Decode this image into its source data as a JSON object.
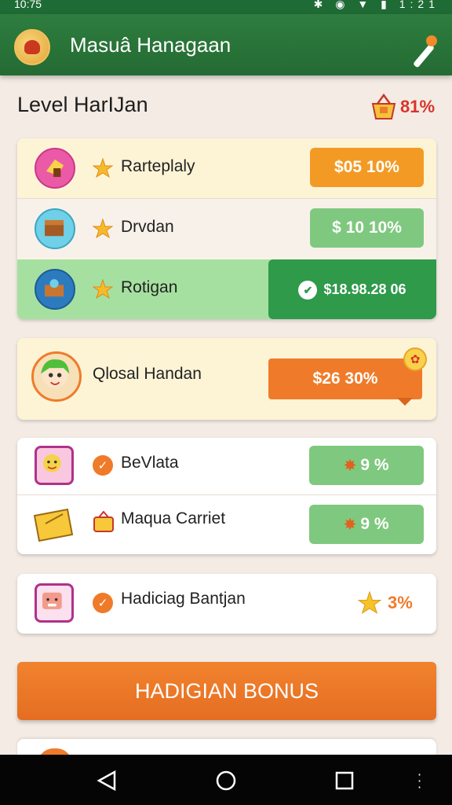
{
  "status_bar": {
    "time": "10:75",
    "right_text": "1:21"
  },
  "app_bar": {
    "title": "Masuâ Hanagaan"
  },
  "level": {
    "title": "Level HarIJan",
    "percent": "81%"
  },
  "group1": {
    "rows": [
      {
        "label": "Rarteplaly",
        "value": "$05 10%",
        "pill_color": "#f39a24"
      },
      {
        "label": "Drvdan",
        "value": "$ 10 10%",
        "pill_color": "#7fc87f"
      },
      {
        "label": "Rotigan",
        "value": "$18.98.28 06",
        "pill_color": "#2f9a4a"
      }
    ]
  },
  "featured": {
    "label": "Qlosal Handan",
    "value": "$26 30%"
  },
  "group2": {
    "rows": [
      {
        "label": "BeVlata",
        "value": "9 %"
      },
      {
        "label": "Maqua Carriet",
        "value": "9 %"
      }
    ]
  },
  "single": {
    "label": "Hadiciag Bantjan",
    "value": "3%"
  },
  "bonus_button": {
    "label": "HADIGIAN BONUS"
  },
  "colors": {
    "appbar_green": "#2e7d3f",
    "accent_orange": "#ef7b2a",
    "pill_green": "#7fc87f",
    "active_green": "#2f9a4a"
  },
  "icons": [
    "menu-logo-icon",
    "brush-icon",
    "basket-icon",
    "star-icon",
    "check-icon",
    "back-icon",
    "home-icon",
    "recents-icon"
  ]
}
